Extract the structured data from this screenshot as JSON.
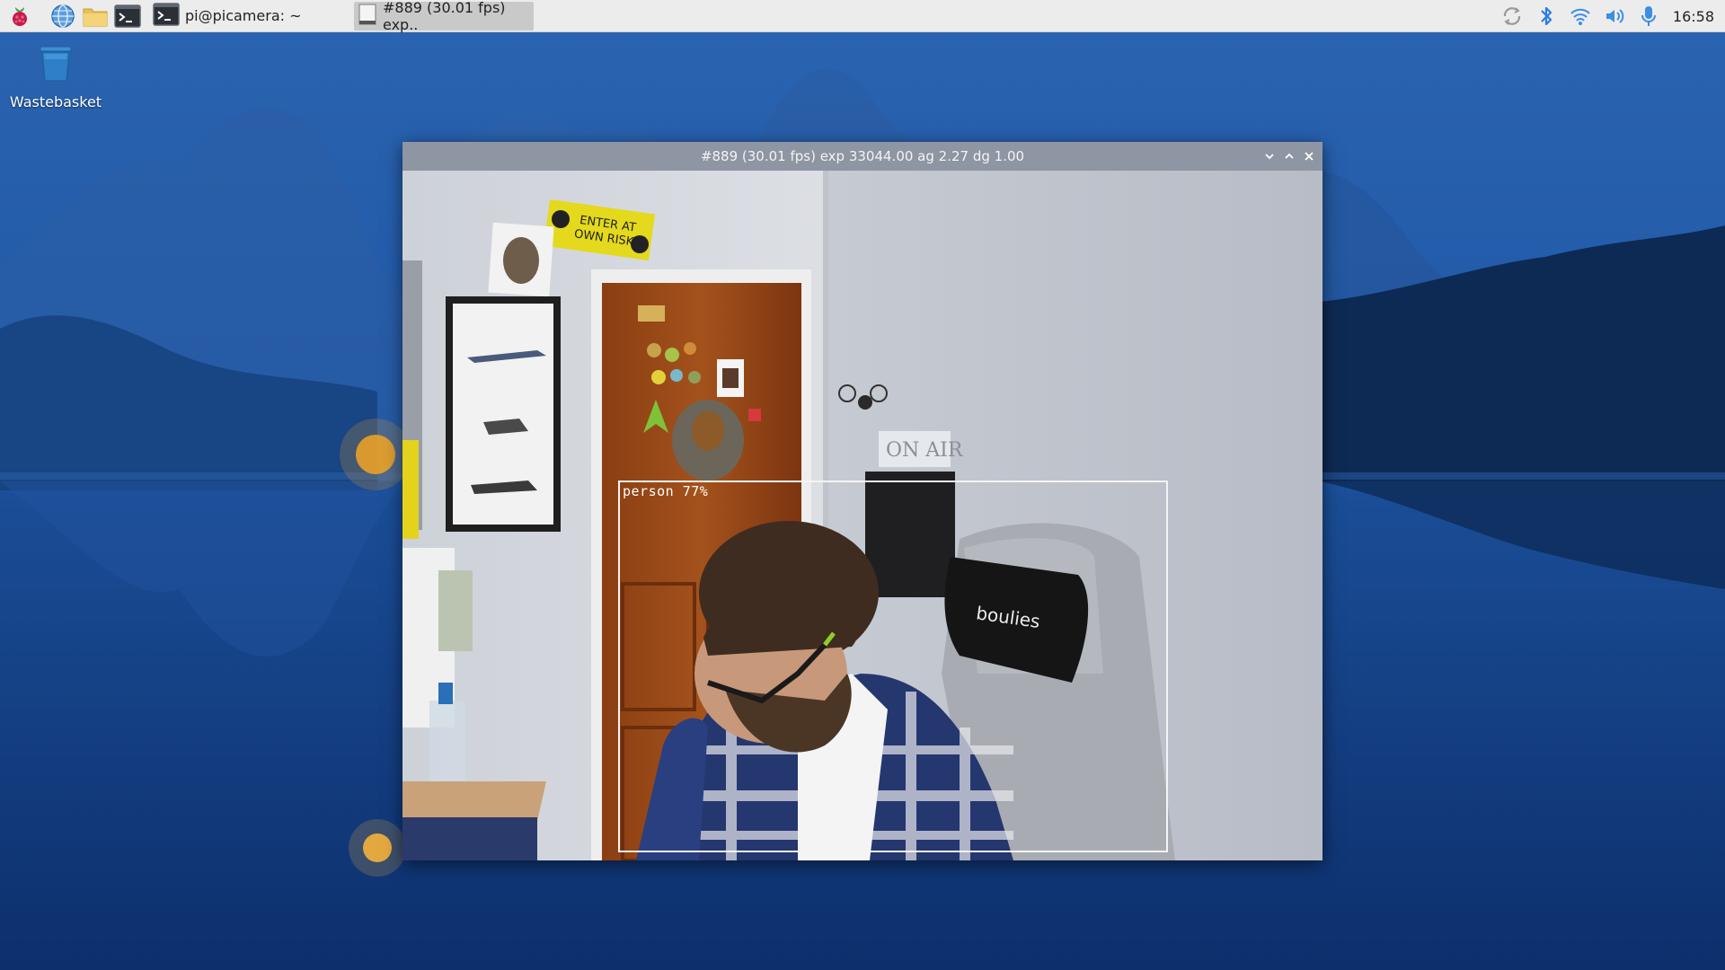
{
  "taskbar": {
    "launchers": [
      {
        "name": "raspberry-menu-icon"
      },
      {
        "name": "web-browser-icon"
      },
      {
        "name": "file-manager-icon"
      },
      {
        "name": "terminal-icon"
      }
    ],
    "tasks": [
      {
        "label": "pi@picamera: ~",
        "icon": "terminal-icon",
        "active": false
      },
      {
        "label": "#889 (30.01 fps) exp..",
        "icon": "window-icon",
        "active": true
      }
    ],
    "tray": [
      "sync-icon",
      "bluetooth-icon",
      "wifi-icon",
      "volume-icon",
      "microphone-icon"
    ],
    "clock": "16:58"
  },
  "desktop": {
    "icons": [
      {
        "label": "Wastebasket",
        "icon": "wastebasket-icon"
      }
    ]
  },
  "camera_window": {
    "title": "#889 (30.01 fps) exp 33044.00 ag 2.27 dg 1.00",
    "buttons": [
      "minimize",
      "maximize",
      "close"
    ],
    "detection": {
      "label": "person 77%",
      "class": "person",
      "confidence_percent": 77
    }
  }
}
